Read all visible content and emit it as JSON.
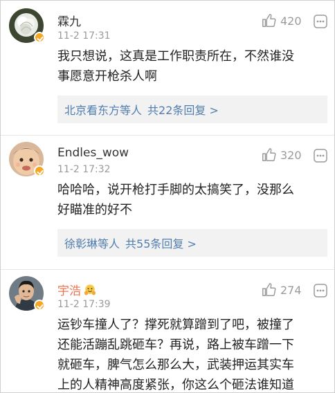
{
  "comments": [
    {
      "username": "霖九",
      "time": "11-2 17:31",
      "likes": "420",
      "text_lines": [
        "我只想说，这真是工作职责所在，不然谁没",
        "事愿意开枪杀人啊"
      ],
      "replies_names": "北京看东方等人",
      "replies_count": "共22条回复 >",
      "verified": true
    },
    {
      "username": "Endles_wow",
      "time": "11-2 17:32",
      "likes": "320",
      "text_lines": [
        "哈哈哈，说开枪打手脚的太搞笑了，没那么",
        "好瞄准的好不"
      ],
      "replies_names": "徐彰琳等人",
      "replies_count": "共55条回复 >",
      "verified": true
    },
    {
      "username": "宇浩",
      "time": "11-2 17:39",
      "likes": "274",
      "text_lines": [
        "运钞车撞人了？撑死就算蹭到了吧，被撞了",
        "还能活蹦乱跳砸车？再说，路上被车蹭一下",
        "就砸车，脾气怎么那么大，武装押运其实车",
        "上的人精神高度紧张，你这么个砸法谁知道"
      ],
      "verified": true,
      "vip_name": true,
      "name_emoji": "face-with-hands-icon"
    }
  ],
  "colors": {
    "link": "#507daf",
    "vip_name": "#eb7350",
    "meta": "#9a9a9a",
    "badge": "#f5a623"
  }
}
